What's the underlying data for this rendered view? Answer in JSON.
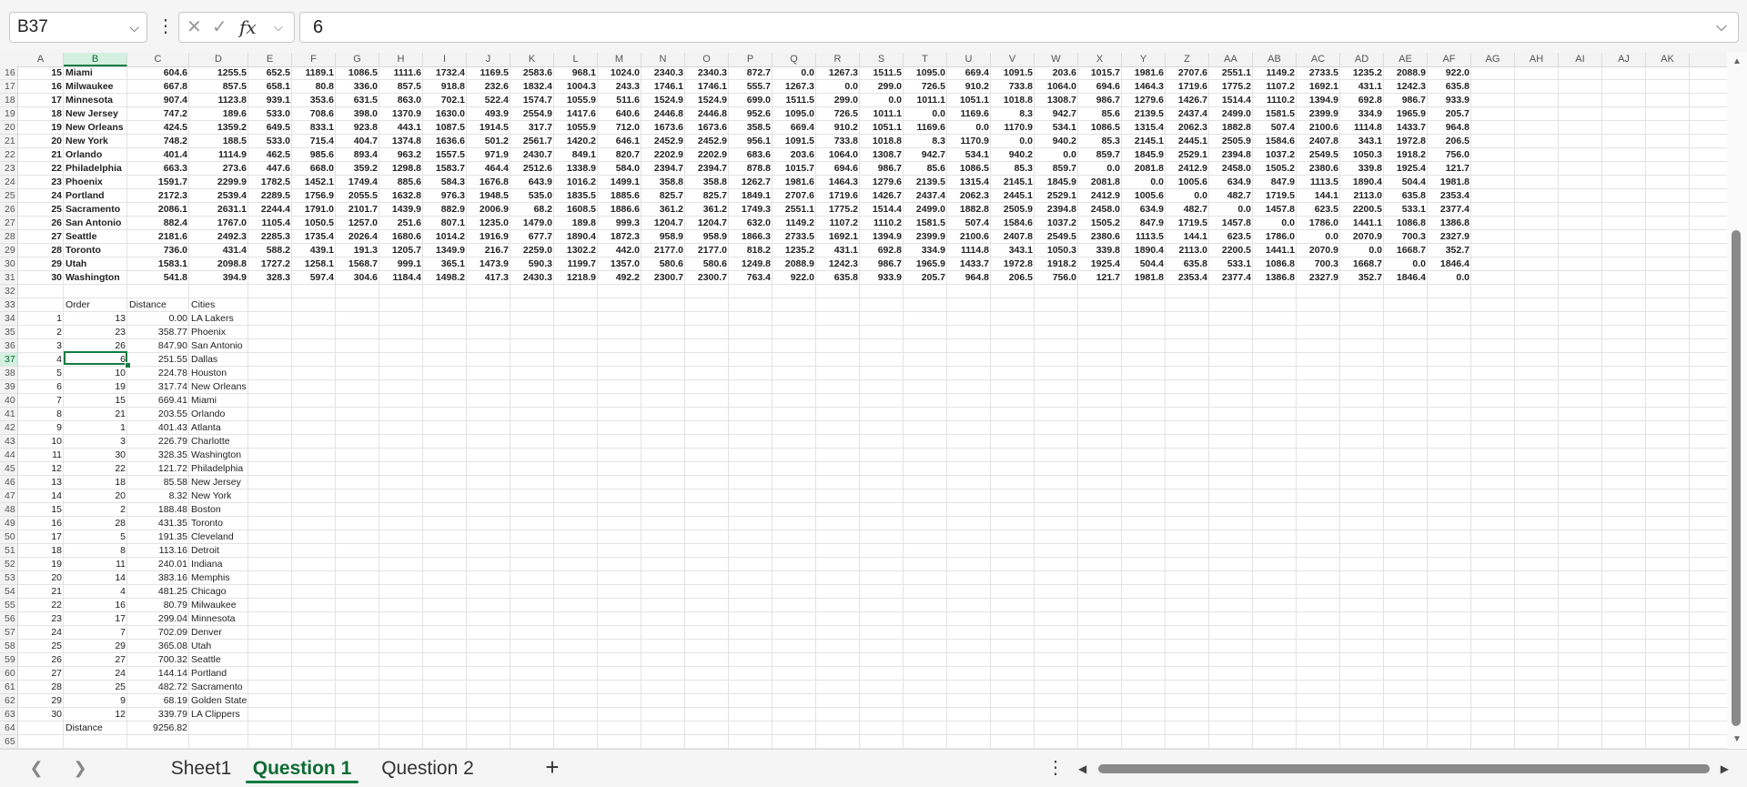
{
  "formula_bar": {
    "name_box": "B37",
    "cancel_glyph": "✕",
    "enter_glyph": "✓",
    "fx_label": "fx",
    "value": "6"
  },
  "columns": [
    "A",
    "B",
    "C",
    "D",
    "E",
    "F",
    "G",
    "H",
    "I",
    "J",
    "K",
    "L",
    "M",
    "N",
    "O",
    "P",
    "Q",
    "R",
    "S",
    "T",
    "U",
    "V",
    "W",
    "X",
    "Y",
    "Z",
    "AA",
    "AB",
    "AC",
    "AD",
    "AE",
    "AF",
    "AG",
    "AH",
    "AI",
    "AJ",
    "AK"
  ],
  "selected_column": "B",
  "row_numbers": [
    "16",
    "17",
    "18",
    "19",
    "20",
    "21",
    "22",
    "23",
    "24",
    "25",
    "26",
    "27",
    "28",
    "29",
    "30",
    "31",
    "32",
    "33",
    "34",
    "35",
    "36",
    "37",
    "38",
    "39",
    "40",
    "41",
    "42",
    "43",
    "44",
    "45",
    "46",
    "47",
    "48",
    "49",
    "50",
    "51",
    "52",
    "53",
    "54",
    "55",
    "56",
    "57",
    "58",
    "59",
    "60",
    "61",
    "62",
    "63",
    "64",
    "65"
  ],
  "selected_row": "37",
  "distance_rows": [
    {
      "idx": "15",
      "city": "Miami",
      "vals": [
        "604.6",
        "1255.5",
        "652.5",
        "1189.1",
        "1086.5",
        "1111.6",
        "1732.4",
        "1169.5",
        "2583.6",
        "968.1",
        "1024.0",
        "2340.3",
        "2340.3",
        "872.7",
        "0.0",
        "1267.3",
        "1511.5",
        "1095.0",
        "669.4",
        "1091.5",
        "203.6",
        "1015.7",
        "1981.6",
        "2707.6",
        "2551.1",
        "1149.2",
        "2733.5",
        "1235.2",
        "2088.9",
        "922.0"
      ]
    },
    {
      "idx": "16",
      "city": "Milwaukee",
      "vals": [
        "667.8",
        "857.5",
        "658.1",
        "80.8",
        "336.0",
        "857.5",
        "918.8",
        "232.6",
        "1832.4",
        "1004.3",
        "243.3",
        "1746.1",
        "1746.1",
        "555.7",
        "1267.3",
        "0.0",
        "299.0",
        "726.5",
        "910.2",
        "733.8",
        "1064.0",
        "694.6",
        "1464.3",
        "1719.6",
        "1775.2",
        "1107.2",
        "1692.1",
        "431.1",
        "1242.3",
        "635.8"
      ]
    },
    {
      "idx": "17",
      "city": "Minnesota",
      "vals": [
        "907.4",
        "1123.8",
        "939.1",
        "353.6",
        "631.5",
        "863.0",
        "702.1",
        "522.4",
        "1574.7",
        "1055.9",
        "511.6",
        "1524.9",
        "1524.9",
        "699.0",
        "1511.5",
        "299.0",
        "0.0",
        "1011.1",
        "1051.1",
        "1018.8",
        "1308.7",
        "986.7",
        "1279.6",
        "1426.7",
        "1514.4",
        "1110.2",
        "1394.9",
        "692.8",
        "986.7",
        "933.9"
      ]
    },
    {
      "idx": "18",
      "city": "New Jersey",
      "vals": [
        "747.2",
        "189.6",
        "533.0",
        "708.6",
        "398.0",
        "1370.9",
        "1630.0",
        "493.9",
        "2554.9",
        "1417.6",
        "640.6",
        "2446.8",
        "2446.8",
        "952.6",
        "1095.0",
        "726.5",
        "1011.1",
        "0.0",
        "1169.6",
        "8.3",
        "942.7",
        "85.6",
        "2139.5",
        "2437.4",
        "2499.0",
        "1581.5",
        "2399.9",
        "334.9",
        "1965.9",
        "205.7"
      ]
    },
    {
      "idx": "19",
      "city": "New Orleans",
      "vals": [
        "424.5",
        "1359.2",
        "649.5",
        "833.1",
        "923.8",
        "443.1",
        "1087.5",
        "1914.5",
        "317.7",
        "1055.9",
        "712.0",
        "1673.6",
        "1673.6",
        "358.5",
        "669.4",
        "910.2",
        "1051.1",
        "1169.6",
        "0.0",
        "1170.9",
        "534.1",
        "1086.5",
        "1315.4",
        "2062.3",
        "1882.8",
        "507.4",
        "2100.6",
        "1114.8",
        "1433.7",
        "964.8"
      ]
    },
    {
      "idx": "20",
      "city": "New York",
      "vals": [
        "748.2",
        "188.5",
        "533.0",
        "715.4",
        "404.7",
        "1374.8",
        "1636.6",
        "501.2",
        "2561.7",
        "1420.2",
        "646.1",
        "2452.9",
        "2452.9",
        "956.1",
        "1091.5",
        "733.8",
        "1018.8",
        "8.3",
        "1170.9",
        "0.0",
        "940.2",
        "85.3",
        "2145.1",
        "2445.1",
        "2505.9",
        "1584.6",
        "2407.8",
        "343.1",
        "1972.8",
        "206.5"
      ]
    },
    {
      "idx": "21",
      "city": "Orlando",
      "vals": [
        "401.4",
        "1114.9",
        "462.5",
        "985.6",
        "893.4",
        "963.2",
        "1557.5",
        "971.9",
        "2430.7",
        "849.1",
        "820.7",
        "2202.9",
        "2202.9",
        "683.6",
        "203.6",
        "1064.0",
        "1308.7",
        "942.7",
        "534.1",
        "940.2",
        "0.0",
        "859.7",
        "1845.9",
        "2529.1",
        "2394.8",
        "1037.2",
        "2549.5",
        "1050.3",
        "1918.2",
        "756.0"
      ]
    },
    {
      "idx": "22",
      "city": "Philadelphia",
      "vals": [
        "663.3",
        "273.6",
        "447.6",
        "668.0",
        "359.2",
        "1298.8",
        "1583.7",
        "464.4",
        "2512.6",
        "1338.9",
        "584.0",
        "2394.7",
        "2394.7",
        "878.8",
        "1015.7",
        "694.6",
        "986.7",
        "85.6",
        "1086.5",
        "85.3",
        "859.7",
        "0.0",
        "2081.8",
        "2412.9",
        "2458.0",
        "1505.2",
        "2380.6",
        "339.8",
        "1925.4",
        "121.7"
      ]
    },
    {
      "idx": "23",
      "city": "Phoenix",
      "vals": [
        "1591.7",
        "2299.9",
        "1782.5",
        "1452.1",
        "1749.4",
        "885.6",
        "584.3",
        "1676.8",
        "643.9",
        "1016.2",
        "1499.1",
        "358.8",
        "358.8",
        "1262.7",
        "1981.6",
        "1464.3",
        "1279.6",
        "2139.5",
        "1315.4",
        "2145.1",
        "1845.9",
        "2081.8",
        "0.0",
        "1005.6",
        "634.9",
        "847.9",
        "1113.5",
        "1890.4",
        "504.4",
        "1981.8"
      ]
    },
    {
      "idx": "24",
      "city": "Portland",
      "vals": [
        "2172.3",
        "2539.4",
        "2289.5",
        "1756.9",
        "2055.5",
        "1632.8",
        "976.3",
        "1948.5",
        "535.0",
        "1835.5",
        "1885.6",
        "825.7",
        "825.7",
        "1849.1",
        "2707.6",
        "1719.6",
        "1426.7",
        "2437.4",
        "2062.3",
        "2445.1",
        "2529.1",
        "2412.9",
        "1005.6",
        "0.0",
        "482.7",
        "1719.5",
        "144.1",
        "2113.0",
        "635.8",
        "2353.4"
      ]
    },
    {
      "idx": "25",
      "city": "Sacramento",
      "vals": [
        "2086.1",
        "2631.1",
        "2244.4",
        "1791.0",
        "2101.7",
        "1439.9",
        "882.9",
        "2006.9",
        "68.2",
        "1608.5",
        "1886.6",
        "361.2",
        "361.2",
        "1749.3",
        "2551.1",
        "1775.2",
        "1514.4",
        "2499.0",
        "1882.8",
        "2505.9",
        "2394.8",
        "2458.0",
        "634.9",
        "482.7",
        "0.0",
        "1457.8",
        "623.5",
        "2200.5",
        "533.1",
        "2377.4"
      ]
    },
    {
      "idx": "26",
      "city": "San Antonio",
      "vals": [
        "882.4",
        "1767.0",
        "1105.4",
        "1050.5",
        "1257.0",
        "251.6",
        "807.1",
        "1235.0",
        "1479.0",
        "189.8",
        "999.3",
        "1204.7",
        "1204.7",
        "632.0",
        "1149.2",
        "1107.2",
        "1110.2",
        "1581.5",
        "507.4",
        "1584.6",
        "1037.2",
        "1505.2",
        "847.9",
        "1719.5",
        "1457.8",
        "0.0",
        "1786.0",
        "1441.1",
        "1086.8",
        "1386.8"
      ]
    },
    {
      "idx": "27",
      "city": "Seattle",
      "vals": [
        "2181.6",
        "2492.3",
        "2285.3",
        "1735.4",
        "2026.4",
        "1680.6",
        "1014.2",
        "1916.9",
        "677.7",
        "1890.4",
        "1872.3",
        "958.9",
        "958.9",
        "1866.3",
        "2733.5",
        "1692.1",
        "1394.9",
        "2399.9",
        "2100.6",
        "2407.8",
        "2549.5",
        "2380.6",
        "1113.5",
        "144.1",
        "623.5",
        "1786.0",
        "0.0",
        "2070.9",
        "700.3",
        "2327.9"
      ]
    },
    {
      "idx": "28",
      "city": "Toronto",
      "vals": [
        "736.0",
        "431.4",
        "588.2",
        "439.1",
        "191.3",
        "1205.7",
        "1349.9",
        "216.7",
        "2259.0",
        "1302.2",
        "442.0",
        "2177.0",
        "2177.0",
        "818.2",
        "1235.2",
        "431.1",
        "692.8",
        "334.9",
        "1114.8",
        "343.1",
        "1050.3",
        "339.8",
        "1890.4",
        "2113.0",
        "2200.5",
        "1441.1",
        "2070.9",
        "0.0",
        "1668.7",
        "352.7"
      ]
    },
    {
      "idx": "29",
      "city": "Utah",
      "vals": [
        "1583.1",
        "2098.8",
        "1727.2",
        "1258.1",
        "1568.7",
        "999.1",
        "365.1",
        "1473.9",
        "590.3",
        "1199.7",
        "1357.0",
        "580.6",
        "580.6",
        "1249.8",
        "2088.9",
        "1242.3",
        "986.7",
        "1965.9",
        "1433.7",
        "1972.8",
        "1918.2",
        "1925.4",
        "504.4",
        "635.8",
        "533.1",
        "1086.8",
        "700.3",
        "1668.7",
        "0.0",
        "1846.4"
      ]
    },
    {
      "idx": "30",
      "city": "Washington",
      "vals": [
        "541.8",
        "394.9",
        "328.3",
        "597.4",
        "304.6",
        "1184.4",
        "1498.2",
        "417.3",
        "2430.3",
        "1218.9",
        "492.2",
        "2300.7",
        "2300.7",
        "763.4",
        "922.0",
        "635.8",
        "933.9",
        "205.7",
        "964.8",
        "206.5",
        "756.0",
        "121.7",
        "1981.8",
        "2353.4",
        "2377.4",
        "1386.8",
        "2327.9",
        "352.7",
        "1846.4",
        "0.0"
      ]
    }
  ],
  "tour_table": {
    "headers": {
      "order": "Order",
      "distance": "Distance",
      "cities": "Cities"
    },
    "rows": [
      {
        "a": "1",
        "b": "13",
        "c": "0.00",
        "d": "LA Lakers"
      },
      {
        "a": "2",
        "b": "23",
        "c": "358.77",
        "d": "Phoenix"
      },
      {
        "a": "3",
        "b": "26",
        "c": "847.90",
        "d": "San Antonio"
      },
      {
        "a": "4",
        "b": "6",
        "c": "251.55",
        "d": "Dallas"
      },
      {
        "a": "5",
        "b": "10",
        "c": "224.78",
        "d": "Houston"
      },
      {
        "a": "6",
        "b": "19",
        "c": "317.74",
        "d": "New Orleans"
      },
      {
        "a": "7",
        "b": "15",
        "c": "669.41",
        "d": "Miami"
      },
      {
        "a": "8",
        "b": "21",
        "c": "203.55",
        "d": "Orlando"
      },
      {
        "a": "9",
        "b": "1",
        "c": "401.43",
        "d": "Atlanta"
      },
      {
        "a": "10",
        "b": "3",
        "c": "226.79",
        "d": "Charlotte"
      },
      {
        "a": "11",
        "b": "30",
        "c": "328.35",
        "d": "Washington"
      },
      {
        "a": "12",
        "b": "22",
        "c": "121.72",
        "d": "Philadelphia"
      },
      {
        "a": "13",
        "b": "18",
        "c": "85.58",
        "d": "New Jersey"
      },
      {
        "a": "14",
        "b": "20",
        "c": "8.32",
        "d": "New York"
      },
      {
        "a": "15",
        "b": "2",
        "c": "188.48",
        "d": "Boston"
      },
      {
        "a": "16",
        "b": "28",
        "c": "431.35",
        "d": "Toronto"
      },
      {
        "a": "17",
        "b": "5",
        "c": "191.35",
        "d": "Cleveland"
      },
      {
        "a": "18",
        "b": "8",
        "c": "113.16",
        "d": "Detroit"
      },
      {
        "a": "19",
        "b": "11",
        "c": "240.01",
        "d": "Indiana"
      },
      {
        "a": "20",
        "b": "14",
        "c": "383.16",
        "d": "Memphis"
      },
      {
        "a": "21",
        "b": "4",
        "c": "481.25",
        "d": "Chicago"
      },
      {
        "a": "22",
        "b": "16",
        "c": "80.79",
        "d": "Milwaukee"
      },
      {
        "a": "23",
        "b": "17",
        "c": "299.04",
        "d": "Minnesota"
      },
      {
        "a": "24",
        "b": "7",
        "c": "702.09",
        "d": "Denver"
      },
      {
        "a": "25",
        "b": "29",
        "c": "365.08",
        "d": "Utah"
      },
      {
        "a": "26",
        "b": "27",
        "c": "700.32",
        "d": "Seattle"
      },
      {
        "a": "27",
        "b": "24",
        "c": "144.14",
        "d": "Portland"
      },
      {
        "a": "28",
        "b": "25",
        "c": "482.72",
        "d": "Sacramento"
      },
      {
        "a": "29",
        "b": "9",
        "c": "68.19",
        "d": "Golden State"
      },
      {
        "a": "30",
        "b": "12",
        "c": "339.79",
        "d": "LA Clippers"
      }
    ],
    "total_label": "Distance",
    "total_value": "9256.82"
  },
  "sheet_tabs": [
    {
      "label": "Sheet1",
      "active": false
    },
    {
      "label": "Question 1",
      "active": true
    },
    {
      "label": "Question 2",
      "active": false
    }
  ],
  "icons": {
    "namebox_dropdown": "chevron-down-icon",
    "cancel": "close-icon",
    "enter": "check-icon",
    "expand_formula": "chevron-down-icon",
    "prev_sheet": "chevron-left-icon",
    "next_sheet": "chevron-right-icon",
    "add_sheet": "plus-icon"
  },
  "colors": {
    "accent": "#107c41",
    "selected_header_bg": "#d3f0e0"
  }
}
